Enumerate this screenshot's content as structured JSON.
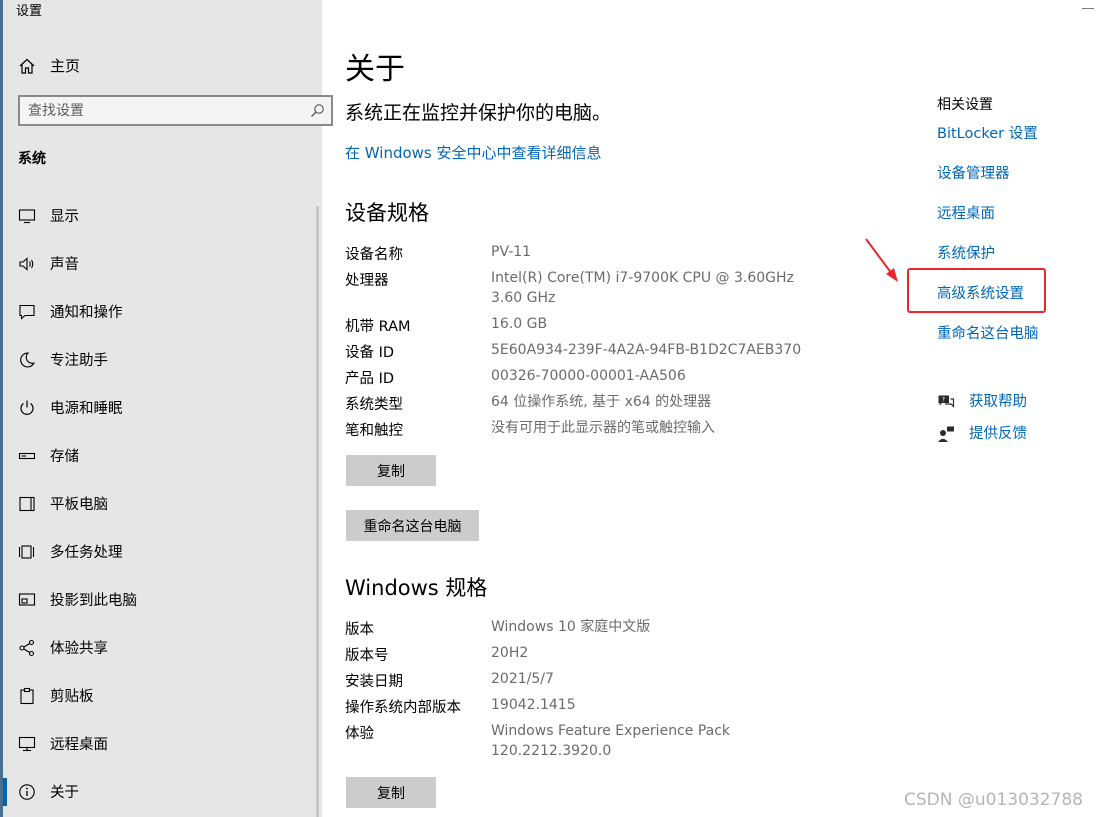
{
  "window": {
    "title": "设置"
  },
  "sidebar": {
    "home_label": "主页",
    "search": {
      "placeholder": "查找设置",
      "value": ""
    },
    "section_title": "系统",
    "items": [
      {
        "label": "显示",
        "icon": "display-icon"
      },
      {
        "label": "声音",
        "icon": "speaker-icon"
      },
      {
        "label": "通知和操作",
        "icon": "notification-icon"
      },
      {
        "label": "专注助手",
        "icon": "moon-icon"
      },
      {
        "label": "电源和睡眠",
        "icon": "power-icon"
      },
      {
        "label": "存储",
        "icon": "storage-icon"
      },
      {
        "label": "平板电脑",
        "icon": "tablet-icon"
      },
      {
        "label": "多任务处理",
        "icon": "multitasking-icon"
      },
      {
        "label": "投影到此电脑",
        "icon": "projection-icon"
      },
      {
        "label": "体验共享",
        "icon": "share-icon"
      },
      {
        "label": "剪贴板",
        "icon": "clipboard-icon"
      },
      {
        "label": "远程桌面",
        "icon": "remote-desktop-icon"
      },
      {
        "label": "关于",
        "icon": "info-icon",
        "active": true
      }
    ]
  },
  "main": {
    "title": "关于",
    "protect_text": "系统正在监控并保护你的电脑。",
    "security_link": "在 Windows 安全中心中查看详细信息",
    "device": {
      "heading": "设备规格",
      "specs": [
        {
          "label": "设备名称",
          "value": "PV-11"
        },
        {
          "label": "处理器",
          "value": "Intel(R) Core(TM) i7-9700K CPU @ 3.60GHz",
          "value2": "3.60 GHz"
        },
        {
          "label": "机带 RAM",
          "value": "16.0 GB"
        },
        {
          "label": "设备 ID",
          "value": "5E60A934-239F-4A2A-94FB-B1D2C7AEB370"
        },
        {
          "label": "产品 ID",
          "value": "00326-70000-00001-AA506"
        },
        {
          "label": "系统类型",
          "value": "64 位操作系统, 基于 x64 的处理器"
        },
        {
          "label": "笔和触控",
          "value": "没有可用于此显示器的笔或触控输入"
        }
      ],
      "copy_button": "复制",
      "rename_button": "重命名这台电脑"
    },
    "windows": {
      "heading": "Windows 规格",
      "specs": [
        {
          "label": "版本",
          "value": "Windows 10 家庭中文版"
        },
        {
          "label": "版本号",
          "value": "20H2"
        },
        {
          "label": "安装日期",
          "value": "2021/5/7"
        },
        {
          "label": "操作系统内部版本",
          "value": "19042.1415"
        },
        {
          "label": "体验",
          "value": "Windows Feature Experience Pack",
          "value2": "120.2212.3920.0"
        }
      ],
      "copy_button": "复制"
    }
  },
  "related": {
    "title": "相关设置",
    "links": [
      "BitLocker 设置",
      "设备管理器",
      "远程桌面",
      "系统保护",
      "高级系统设置",
      "重命名这台电脑"
    ],
    "help": [
      {
        "label": "获取帮助",
        "icon": "help-chat-icon"
      },
      {
        "label": "提供反馈",
        "icon": "feedback-icon"
      }
    ]
  },
  "annotation": {
    "highlight_color": "#e8262b"
  },
  "colors": {
    "link": "#0067b8",
    "sidebar_bg": "#e6e6e6",
    "button_bg": "#cccccc"
  },
  "watermark": "CSDN @u013032788"
}
